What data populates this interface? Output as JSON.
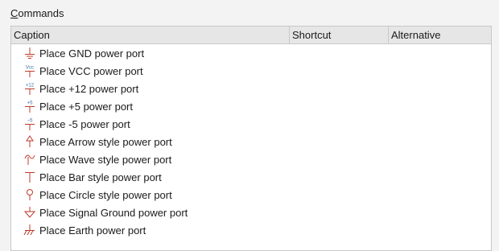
{
  "group": {
    "label_accel": "C",
    "label_rest": "ommands"
  },
  "columns": {
    "caption": "Caption",
    "shortcut": "Shortcut",
    "alternative": "Alternative"
  },
  "colors": {
    "icon_red": "#c0392b",
    "icon_blue": "#3a6ea5"
  },
  "rows": [
    {
      "icon": "gnd-power-port-icon",
      "caption": "Place GND power port"
    },
    {
      "icon": "vcc-power-port-icon",
      "caption": "Place VCC power port",
      "icon_text": "Vcc"
    },
    {
      "icon": "plus12-power-port-icon",
      "caption": "Place +12 power port",
      "icon_text": "+12"
    },
    {
      "icon": "plus5-power-port-icon",
      "caption": "Place +5 power port",
      "icon_text": "+5"
    },
    {
      "icon": "minus5-power-port-icon",
      "caption": "Place -5 power port",
      "icon_text": "−5"
    },
    {
      "icon": "arrow-power-port-icon",
      "caption": "Place Arrow style power port"
    },
    {
      "icon": "wave-power-port-icon",
      "caption": "Place Wave style power port"
    },
    {
      "icon": "bar-power-port-icon",
      "caption": "Place Bar style power port"
    },
    {
      "icon": "circle-power-port-icon",
      "caption": "Place Circle style power port"
    },
    {
      "icon": "signal-ground-power-port-icon",
      "caption": "Place Signal Ground power port"
    },
    {
      "icon": "earth-power-port-icon",
      "caption": "Place Earth power port"
    }
  ]
}
